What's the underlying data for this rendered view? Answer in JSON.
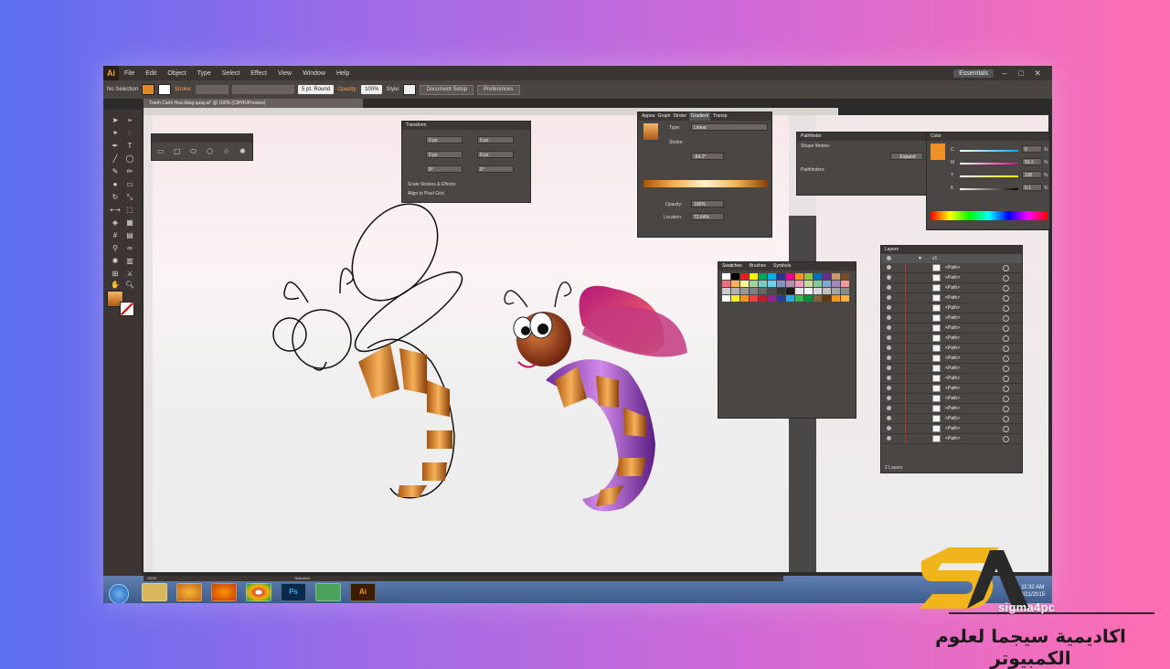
{
  "menu": {
    "logo": "Ai",
    "items": [
      "File",
      "Edit",
      "Object",
      "Type",
      "Select",
      "Effect",
      "View",
      "Window",
      "Help"
    ],
    "workspace": "Essentials",
    "window_controls": [
      "–",
      "□",
      "✕"
    ]
  },
  "control_bar": {
    "selection": "No Selection",
    "stroke_label": "Stroke:",
    "brush": "5 pt. Round",
    "opacity_label": "Opacity:",
    "opacity_value": "100%",
    "style_label": "Style:",
    "document_setup": "Document Setup",
    "preferences": "Preferences"
  },
  "document_tab": "Tranh Canh Hoa dang quay.ai* @ 100% (CMYK/Preview)",
  "panels": {
    "transform": {
      "title": "Transform",
      "fields": [
        "0 px",
        "0 px",
        "0 px",
        "0 px",
        "0°",
        "0°"
      ],
      "options": [
        "Scale Strokes & Effects",
        "Align to Pixel Grid"
      ]
    },
    "gradient": {
      "tabs": [
        "Appea",
        "Graph",
        "Stroke",
        "Gradient",
        "Transp"
      ],
      "type_label": "Type:",
      "type_value": "Linear",
      "stroke_label": "Stroke:",
      "angle": "-84.2°",
      "opacity_label": "Opacity:",
      "opacity_value": "100%",
      "location_label": "Location:",
      "location_value": "72.64%"
    },
    "pathfinder": {
      "title": "Pathfinder",
      "shape_modes": "Shape Modes:",
      "pathfinders": "Pathfinders:",
      "expand": "Expand"
    },
    "color": {
      "title": "Color",
      "channels": [
        {
          "label": "C",
          "value": "0",
          "unit": "%"
        },
        {
          "label": "M",
          "value": "50.2",
          "unit": "%"
        },
        {
          "label": "Y",
          "value": "100",
          "unit": "%"
        },
        {
          "label": "K",
          "value": "5.1",
          "unit": "%"
        }
      ]
    },
    "swatches": {
      "tabs": [
        "Swatches",
        "Brushes",
        "Symbols"
      ]
    },
    "layers": {
      "title": "Layers",
      "top_layer": "v1",
      "rows": [
        "<Path>",
        "<Path>",
        "<Path>",
        "<Path>",
        "<Path>",
        "<Path>",
        "<Path>",
        "<Path>",
        "<Path>",
        "<Path>",
        "<Path>",
        "<Path>",
        "<Path>",
        "<Path>",
        "<Path>",
        "<Path>",
        "<Path>",
        "<Path>"
      ],
      "footer": "2 Layers"
    }
  },
  "status_bar": {
    "zoom": "100%",
    "mode": "Selection"
  },
  "taskbar": {
    "items": [
      "folder",
      "media",
      "firefox",
      "chrome",
      "Ps",
      "app",
      "Ai"
    ],
    "time": "11:32 AM",
    "date": "8/21/2015"
  },
  "brand": {
    "name": "sigma4pc",
    "arabic": "اكاديمية سيجما لعلوم الكمبيوتر"
  },
  "colors": {
    "accent": "#f5a623",
    "ui_dark": "#4a4644",
    "brand_gold": "#f1b51c"
  }
}
